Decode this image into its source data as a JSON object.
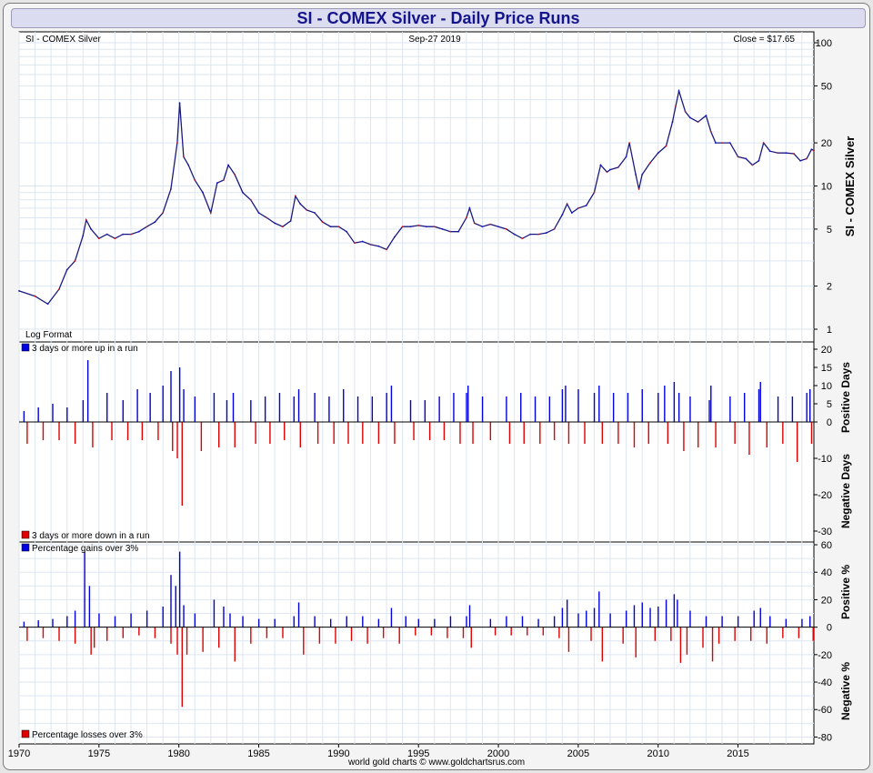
{
  "header": {
    "title": "SI  -  COMEX Silver - Daily Price Runs"
  },
  "panel_price": {
    "symbol_label": "SI  -  COMEX Silver",
    "date_label": "Sep-27  2019",
    "close_label": "Close = $17.65",
    "format_label": "Log Format",
    "axis_label": "SI  -  COMEX Silver"
  },
  "panel_runs": {
    "legend_up": "3 days or more up in a run",
    "legend_down": "3 days or more down in a run",
    "axis_label_pos": "Positive Days",
    "axis_label_neg": "Negative Days"
  },
  "panel_pct": {
    "legend_gain": "Percentage gains over 3%",
    "legend_loss": "Percentage losses over 3%",
    "axis_label_pos": "Positive %",
    "axis_label_neg": "Negative %"
  },
  "footer": {
    "credit": "world gold charts © www.goldchartsrus.com"
  },
  "colors": {
    "title": "#14148c",
    "up": "#0000e0",
    "down": "#e00000",
    "price_line": "#1a1a80"
  },
  "chart_data": [
    {
      "type": "line",
      "title": "SI  -  COMEX Silver",
      "scale": "log",
      "x_range": [
        1970,
        2019.75
      ],
      "ylim": [
        1,
        100
      ],
      "y_ticks": [
        1,
        2,
        5,
        10,
        20,
        50,
        100
      ],
      "x_ticks": [
        1970,
        1975,
        1980,
        1985,
        1990,
        1995,
        2000,
        2005,
        2010,
        2015
      ],
      "grid": true,
      "series": [
        {
          "x": [
            1970.0,
            1971.0,
            1971.8,
            1972.5,
            1973.0,
            1973.5,
            1974.0,
            1974.2,
            1974.5,
            1975.0,
            1975.5,
            1976.0,
            1976.5,
            1977.0,
            1977.5,
            1978.0,
            1978.5,
            1979.0,
            1979.5,
            1979.9,
            1980.05,
            1980.3,
            1980.6,
            1981.0,
            1981.5,
            1982.0,
            1982.4,
            1982.8,
            1983.1,
            1983.5,
            1984.0,
            1984.5,
            1985.0,
            1985.5,
            1986.0,
            1986.5,
            1987.0,
            1987.3,
            1987.6,
            1988.0,
            1988.5,
            1989.0,
            1989.5,
            1990.0,
            1990.5,
            1991.0,
            1991.5,
            1992.0,
            1992.5,
            1993.0,
            1993.5,
            1994.0,
            1994.5,
            1995.0,
            1995.5,
            1996.0,
            1996.5,
            1997.0,
            1997.5,
            1998.0,
            1998.2,
            1998.5,
            1999.0,
            1999.5,
            2000.0,
            2000.5,
            2001.0,
            2001.5,
            2002.0,
            2002.5,
            2003.0,
            2003.5,
            2004.0,
            2004.3,
            2004.6,
            2005.0,
            2005.5,
            2006.0,
            2006.4,
            2006.8,
            2007.0,
            2007.5,
            2008.0,
            2008.2,
            2008.6,
            2008.8,
            2009.0,
            2009.5,
            2010.0,
            2010.5,
            2010.9,
            2011.1,
            2011.3,
            2011.7,
            2012.0,
            2012.5,
            2013.0,
            2013.3,
            2013.6,
            2014.0,
            2014.5,
            2015.0,
            2015.5,
            2015.9,
            2016.3,
            2016.6,
            2017.0,
            2017.5,
            2018.0,
            2018.5,
            2018.9,
            2019.3,
            2019.6,
            2019.75
          ],
          "y": [
            1.85,
            1.7,
            1.5,
            1.9,
            2.6,
            3.0,
            4.5,
            5.8,
            5.0,
            4.3,
            4.6,
            4.3,
            4.6,
            4.6,
            4.8,
            5.2,
            5.6,
            6.5,
            9.5,
            20,
            38,
            16,
            14,
            11,
            9.0,
            6.5,
            10.5,
            11.0,
            14.0,
            12.0,
            9.0,
            8.0,
            6.5,
            6.0,
            5.5,
            5.2,
            5.7,
            8.5,
            7.5,
            6.8,
            6.5,
            5.6,
            5.2,
            5.2,
            4.8,
            4.0,
            4.1,
            3.9,
            3.8,
            3.6,
            4.4,
            5.2,
            5.2,
            5.3,
            5.2,
            5.2,
            5.0,
            4.8,
            4.8,
            6.0,
            7.0,
            5.5,
            5.2,
            5.4,
            5.2,
            5.0,
            4.6,
            4.3,
            4.6,
            4.6,
            4.7,
            5.0,
            6.3,
            7.5,
            6.5,
            7.0,
            7.3,
            9.0,
            14.0,
            12.5,
            13.0,
            13.5,
            16.0,
            20.0,
            12.0,
            9.5,
            12.0,
            14.5,
            17.0,
            19.0,
            28.0,
            36.0,
            46.0,
            33.0,
            30.0,
            28.0,
            31.0,
            24.0,
            20.0,
            20.0,
            20.0,
            16.0,
            15.5,
            14.0,
            15.0,
            20.0,
            17.5,
            17.0,
            17.0,
            16.8,
            15.0,
            15.5,
            18.0,
            17.65
          ]
        }
      ]
    },
    {
      "type": "bar",
      "title": "",
      "x_range": [
        1970,
        2019.75
      ],
      "ylim": [
        -33,
        22
      ],
      "y_ticks": [
        20,
        15,
        10,
        5,
        0,
        -10,
        -20,
        -30
      ],
      "series": [
        {
          "name": "3 days or more up in a run",
          "x": [
            1970.3,
            1971.2,
            1972.1,
            1973.0,
            1974.0,
            1974.3,
            1975.5,
            1976.5,
            1977.4,
            1978.2,
            1979.0,
            1979.5,
            1980.05,
            1980.3,
            1981.0,
            1982.2,
            1983.0,
            1983.4,
            1984.5,
            1985.4,
            1986.3,
            1987.2,
            1987.5,
            1988.5,
            1989.4,
            1990.3,
            1991.2,
            1992.1,
            1993.0,
            1993.3,
            1994.5,
            1995.4,
            1996.3,
            1997.2,
            1998.0,
            1998.1,
            1999.0,
            2000.5,
            2001.4,
            2002.3,
            2003.2,
            2004.0,
            2004.2,
            2005.0,
            2006.0,
            2006.3,
            2007.2,
            2008.1,
            2009.0,
            2010.0,
            2010.4,
            2011.0,
            2011.3,
            2012.0,
            2013.2,
            2013.3,
            2014.5,
            2015.4,
            2016.3,
            2016.4,
            2017.5,
            2018.4,
            2019.3,
            2019.5
          ],
          "values": [
            3,
            4,
            5,
            4,
            6,
            17,
            8,
            6,
            9,
            8,
            10,
            14,
            15,
            9,
            7,
            8,
            6,
            8,
            6,
            7,
            8,
            7,
            9,
            8,
            7,
            9,
            7,
            7,
            8,
            10,
            6,
            6,
            7,
            8,
            8,
            10,
            7,
            7,
            8,
            7,
            7,
            9,
            10,
            9,
            8,
            10,
            8,
            8,
            9,
            8,
            10,
            11,
            8,
            7,
            6,
            10,
            7,
            8,
            9,
            11,
            7,
            7,
            8,
            9
          ]
        },
        {
          "name": "3 days or more down in a run",
          "x": [
            1970.5,
            1971.5,
            1972.5,
            1973.5,
            1974.6,
            1975.8,
            1976.8,
            1977.7,
            1978.7,
            1979.6,
            1979.9,
            1980.2,
            1981.4,
            1982.5,
            1983.5,
            1984.8,
            1985.7,
            1986.6,
            1987.6,
            1988.7,
            1989.7,
            1990.6,
            1991.5,
            1992.5,
            1993.5,
            1994.7,
            1995.7,
            1996.6,
            1997.6,
            1998.4,
            1999.5,
            2000.7,
            2001.6,
            2002.6,
            2003.5,
            2004.4,
            2005.4,
            2006.5,
            2007.5,
            2008.5,
            2009.4,
            2010.6,
            2011.6,
            2012.5,
            2013.6,
            2014.8,
            2015.7,
            2016.8,
            2017.8,
            2018.7,
            2019.6
          ],
          "values": [
            -6,
            -5,
            -5,
            -6,
            -7,
            -5,
            -5,
            -5,
            -5,
            -8,
            -10,
            -23,
            -8,
            -7,
            -7,
            -6,
            -6,
            -5,
            -7,
            -6,
            -6,
            -6,
            -6,
            -6,
            -6,
            -5,
            -5,
            -5,
            -6,
            -6,
            -5,
            -6,
            -6,
            -6,
            -5,
            -6,
            -6,
            -6,
            -6,
            -7,
            -6,
            -6,
            -8,
            -7,
            -7,
            -6,
            -9,
            -7,
            -6,
            -11,
            -6
          ]
        }
      ]
    },
    {
      "type": "bar",
      "title": "",
      "x_range": [
        1970,
        2019.75
      ],
      "ylim": [
        -85,
        62
      ],
      "y_ticks": [
        60,
        40,
        20,
        0,
        -20,
        -40,
        -60,
        -80
      ],
      "series": [
        {
          "name": "Percentage gains over 3%",
          "x": [
            1970.3,
            1971.2,
            1972.1,
            1973.0,
            1973.5,
            1974.1,
            1974.4,
            1975.0,
            1976.0,
            1977.0,
            1978.0,
            1979.0,
            1979.5,
            1979.8,
            1980.05,
            1980.3,
            1981.0,
            1982.2,
            1982.8,
            1983.2,
            1984.0,
            1985.0,
            1986.0,
            1987.2,
            1987.5,
            1988.5,
            1989.5,
            1990.5,
            1991.5,
            1992.5,
            1993.3,
            1994.2,
            1995.0,
            1996.0,
            1997.0,
            1998.0,
            1998.2,
            1999.5,
            2000.5,
            2001.5,
            2002.5,
            2003.5,
            2004.0,
            2004.3,
            2005.0,
            2005.5,
            2006.0,
            2006.3,
            2007.0,
            2008.0,
            2008.5,
            2009.0,
            2009.5,
            2010.0,
            2010.5,
            2011.0,
            2011.2,
            2012.0,
            2013.0,
            2014.0,
            2015.0,
            2016.0,
            2016.4,
            2017.0,
            2018.0,
            2019.0,
            2019.5
          ],
          "values": [
            4,
            5,
            6,
            8,
            12,
            55,
            30,
            10,
            8,
            10,
            12,
            15,
            38,
            30,
            55,
            16,
            10,
            20,
            15,
            10,
            8,
            6,
            6,
            8,
            18,
            8,
            6,
            8,
            8,
            6,
            14,
            8,
            6,
            6,
            8,
            8,
            16,
            6,
            8,
            8,
            6,
            8,
            14,
            20,
            10,
            12,
            14,
            26,
            10,
            12,
            16,
            18,
            14,
            15,
            20,
            24,
            20,
            12,
            8,
            8,
            8,
            12,
            14,
            8,
            6,
            6,
            8
          ]
        },
        {
          "name": "Percentage losses over 3%",
          "x": [
            1970.5,
            1971.5,
            1972.5,
            1973.5,
            1974.5,
            1974.7,
            1975.5,
            1976.5,
            1977.5,
            1978.5,
            1979.5,
            1979.9,
            1980.2,
            1980.5,
            1981.5,
            1982.5,
            1983.5,
            1984.5,
            1985.5,
            1986.5,
            1987.8,
            1988.8,
            1989.8,
            1990.8,
            1991.8,
            1992.8,
            1993.8,
            1994.8,
            1995.8,
            1996.8,
            1997.8,
            1998.3,
            1999.8,
            2000.8,
            2001.8,
            2002.8,
            2003.8,
            2004.4,
            2005.8,
            2006.5,
            2007.8,
            2008.6,
            2009.8,
            2010.8,
            2011.4,
            2011.8,
            2012.8,
            2013.4,
            2013.8,
            2014.8,
            2015.8,
            2016.8,
            2017.8,
            2018.8,
            2019.7
          ],
          "values": [
            -10,
            -8,
            -10,
            -12,
            -20,
            -15,
            -10,
            -8,
            -6,
            -8,
            -12,
            -20,
            -58,
            -20,
            -18,
            -15,
            -25,
            -12,
            -8,
            -8,
            -20,
            -12,
            -12,
            -10,
            -12,
            -8,
            -12,
            -6,
            -6,
            -8,
            -8,
            -15,
            -6,
            -6,
            -6,
            -6,
            -8,
            -18,
            -10,
            -25,
            -12,
            -22,
            -10,
            -10,
            -26,
            -20,
            -15,
            -25,
            -12,
            -10,
            -10,
            -12,
            -8,
            -8,
            -10
          ]
        }
      ]
    }
  ]
}
